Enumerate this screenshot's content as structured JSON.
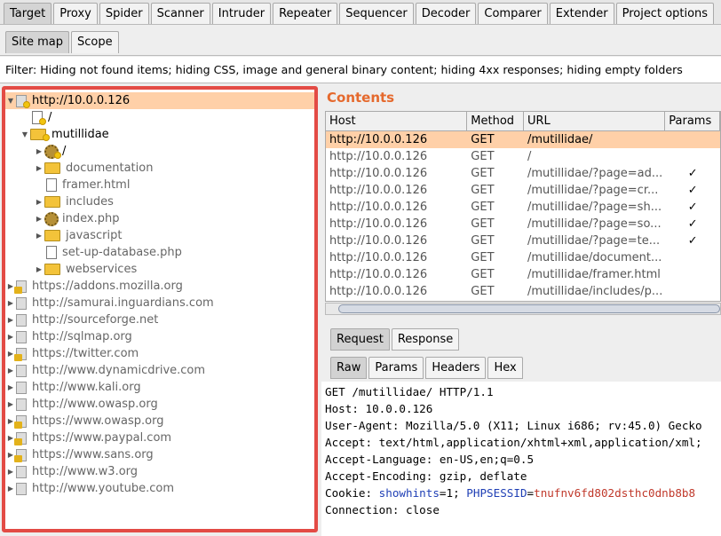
{
  "main_tabs": [
    {
      "label": "Target",
      "active": true
    },
    {
      "label": "Proxy"
    },
    {
      "label": "Spider"
    },
    {
      "label": "Scanner"
    },
    {
      "label": "Intruder"
    },
    {
      "label": "Repeater"
    },
    {
      "label": "Sequencer"
    },
    {
      "label": "Decoder"
    },
    {
      "label": "Comparer"
    },
    {
      "label": "Extender"
    },
    {
      "label": "Project options"
    }
  ],
  "sub_tabs": [
    {
      "label": "Site map",
      "active": true
    },
    {
      "label": "Scope"
    }
  ],
  "filter_text": "Filter: Hiding not found items;  hiding CSS, image and general binary content;  hiding 4xx responses;  hiding empty folders",
  "tree": [
    {
      "label": "http://10.0.0.126",
      "icon": "site-icon",
      "level": 0,
      "arrow": "open",
      "selected": true
    },
    {
      "label": "/",
      "icon": "page-icon",
      "level": 1,
      "arrow": "none"
    },
    {
      "label": "mutillidae",
      "icon": "folder-icon",
      "level": 1,
      "arrow": "open"
    },
    {
      "label": "/",
      "icon": "gear-icon",
      "level": 2,
      "arrow": "closed"
    },
    {
      "label": "documentation",
      "icon": "folder-icon",
      "level": 2,
      "arrow": "closed",
      "grey": true
    },
    {
      "label": "framer.html",
      "icon": "page-icon",
      "level": 2,
      "arrow": "none",
      "grey": true
    },
    {
      "label": "includes",
      "icon": "folder-icon",
      "level": 2,
      "arrow": "closed",
      "grey": true
    },
    {
      "label": "index.php",
      "icon": "gear-icon",
      "level": 2,
      "arrow": "closed",
      "grey": true
    },
    {
      "label": "javascript",
      "icon": "folder-icon",
      "level": 2,
      "arrow": "closed",
      "grey": true
    },
    {
      "label": "set-up-database.php",
      "icon": "page-icon",
      "level": 2,
      "arrow": "none",
      "grey": true
    },
    {
      "label": "webservices",
      "icon": "folder-icon",
      "level": 2,
      "arrow": "closed",
      "grey": true
    },
    {
      "label": "https://addons.mozilla.org",
      "icon": "lock-icon",
      "level": 0,
      "arrow": "closed",
      "grey": true
    },
    {
      "label": "http://samurai.inguardians.com",
      "icon": "site-icon",
      "level": 0,
      "arrow": "closed",
      "grey": true
    },
    {
      "label": "http://sourceforge.net",
      "icon": "site-icon",
      "level": 0,
      "arrow": "closed",
      "grey": true
    },
    {
      "label": "http://sqlmap.org",
      "icon": "site-icon",
      "level": 0,
      "arrow": "closed",
      "grey": true
    },
    {
      "label": "https://twitter.com",
      "icon": "lock-icon",
      "level": 0,
      "arrow": "closed",
      "grey": true
    },
    {
      "label": "http://www.dynamicdrive.com",
      "icon": "site-icon",
      "level": 0,
      "arrow": "closed",
      "grey": true
    },
    {
      "label": "http://www.kali.org",
      "icon": "site-icon",
      "level": 0,
      "arrow": "closed",
      "grey": true
    },
    {
      "label": "http://www.owasp.org",
      "icon": "site-icon",
      "level": 0,
      "arrow": "closed",
      "grey": true
    },
    {
      "label": "https://www.owasp.org",
      "icon": "lock-icon",
      "level": 0,
      "arrow": "closed",
      "grey": true
    },
    {
      "label": "https://www.paypal.com",
      "icon": "lock-icon",
      "level": 0,
      "arrow": "closed",
      "grey": true
    },
    {
      "label": "https://www.sans.org",
      "icon": "lock-icon",
      "level": 0,
      "arrow": "closed",
      "grey": true
    },
    {
      "label": "http://www.w3.org",
      "icon": "site-icon",
      "level": 0,
      "arrow": "closed",
      "grey": true
    },
    {
      "label": "http://www.youtube.com",
      "icon": "site-icon",
      "level": 0,
      "arrow": "closed",
      "grey": true
    }
  ],
  "contents_title": "Contents",
  "columns": [
    "Host",
    "Method",
    "URL",
    "Params"
  ],
  "rows": [
    {
      "host": "http://10.0.0.126",
      "method": "GET",
      "url": "/mutillidae/",
      "params": "",
      "selected": true
    },
    {
      "host": "http://10.0.0.126",
      "method": "GET",
      "url": "/",
      "params": ""
    },
    {
      "host": "http://10.0.0.126",
      "method": "GET",
      "url": "/mutillidae/?page=ad...",
      "params": "✓"
    },
    {
      "host": "http://10.0.0.126",
      "method": "GET",
      "url": "/mutillidae/?page=cr...",
      "params": "✓"
    },
    {
      "host": "http://10.0.0.126",
      "method": "GET",
      "url": "/mutillidae/?page=sh...",
      "params": "✓"
    },
    {
      "host": "http://10.0.0.126",
      "method": "GET",
      "url": "/mutillidae/?page=so...",
      "params": "✓"
    },
    {
      "host": "http://10.0.0.126",
      "method": "GET",
      "url": "/mutillidae/?page=te...",
      "params": "✓"
    },
    {
      "host": "http://10.0.0.126",
      "method": "GET",
      "url": "/mutillidae/document...",
      "params": ""
    },
    {
      "host": "http://10.0.0.126",
      "method": "GET",
      "url": "/mutillidae/framer.html",
      "params": ""
    },
    {
      "host": "http://10.0.0.126",
      "method": "GET",
      "url": "/mutillidae/includes/p...",
      "params": ""
    }
  ],
  "req_tabs": [
    {
      "label": "Request",
      "active": true
    },
    {
      "label": "Response"
    }
  ],
  "view_tabs": [
    {
      "label": "Raw",
      "active": true
    },
    {
      "label": "Params"
    },
    {
      "label": "Headers"
    },
    {
      "label": "Hex"
    }
  ],
  "request_lines": [
    "GET /mutillidae/ HTTP/1.1",
    "Host: 10.0.0.126",
    "User-Agent: Mozilla/5.0 (X11; Linux i686; rv:45.0) Gecko",
    "Accept: text/html,application/xhtml+xml,application/xml;",
    "Accept-Language: en-US,en;q=0.5",
    "Accept-Encoding: gzip, deflate"
  ],
  "cookie": {
    "prefix": "Cookie: ",
    "name1": "showhints",
    "eq1": "=",
    "val1": "1",
    "sep": "; ",
    "name2": "PHPSESSID",
    "eq2": "=",
    "val2": "tnufnv6fd802dsthc0dnb8b8"
  },
  "connection_line": "Connection: close"
}
